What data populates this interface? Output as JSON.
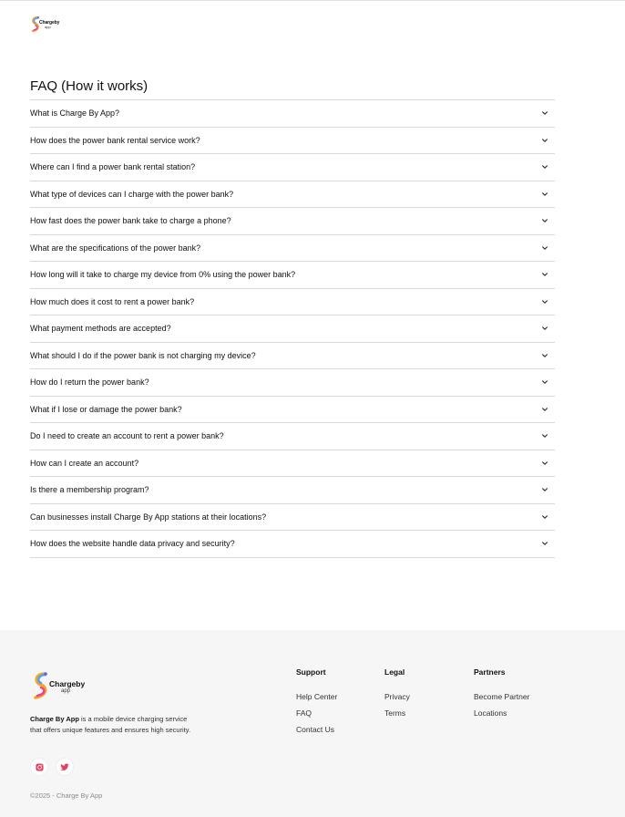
{
  "header": {
    "logo_text": "Chargeby",
    "logo_sub": "app"
  },
  "faq": {
    "title": "FAQ (How it works)",
    "items": [
      "What is Charge By App?",
      "How does the power bank rental service work?",
      "Where can I find a power bank rental station?",
      "What type of devices can I charge with the power bank?",
      "How fast does the power bank take to charge a phone?",
      "What are the specifications of the power bank?",
      "How long will it take to charge my device from 0% using the power bank?",
      "How much does it cost to rent a power bank?",
      "What payment methods are accepted?",
      "What should I do if the power bank is not charging my device?",
      "How do I return the power bank?",
      "What if I lose or damage the power bank?",
      "Do I need to create an account to rent a power bank?",
      "How can I create an account?",
      "Is there a membership program?",
      "Can businesses install Charge By App stations at their locations?",
      "How does the website handle data privacy and security?"
    ],
    "item_icon": "chevron-down-icon"
  },
  "footer": {
    "logo_text": "Chargeby",
    "logo_sub": "app",
    "brand": "Charge By App",
    "description": " is a mobile device charging service that offers unique features and ensures high security.",
    "social": [
      {
        "icon": "instagram-icon",
        "color": "#e4405f"
      },
      {
        "icon": "twitter-icon",
        "color": "#e4405f"
      }
    ],
    "columns": {
      "support": {
        "title": "Support",
        "links": [
          "Help Center",
          "FAQ",
          "Contact Us"
        ]
      },
      "legal": {
        "title": "Legal",
        "links": [
          "Privacy",
          "Terms"
        ]
      },
      "partners": {
        "title": "Partners",
        "links": [
          "Become Partner",
          "Locations"
        ]
      }
    },
    "copyright": "©2025 - Charge By App"
  }
}
